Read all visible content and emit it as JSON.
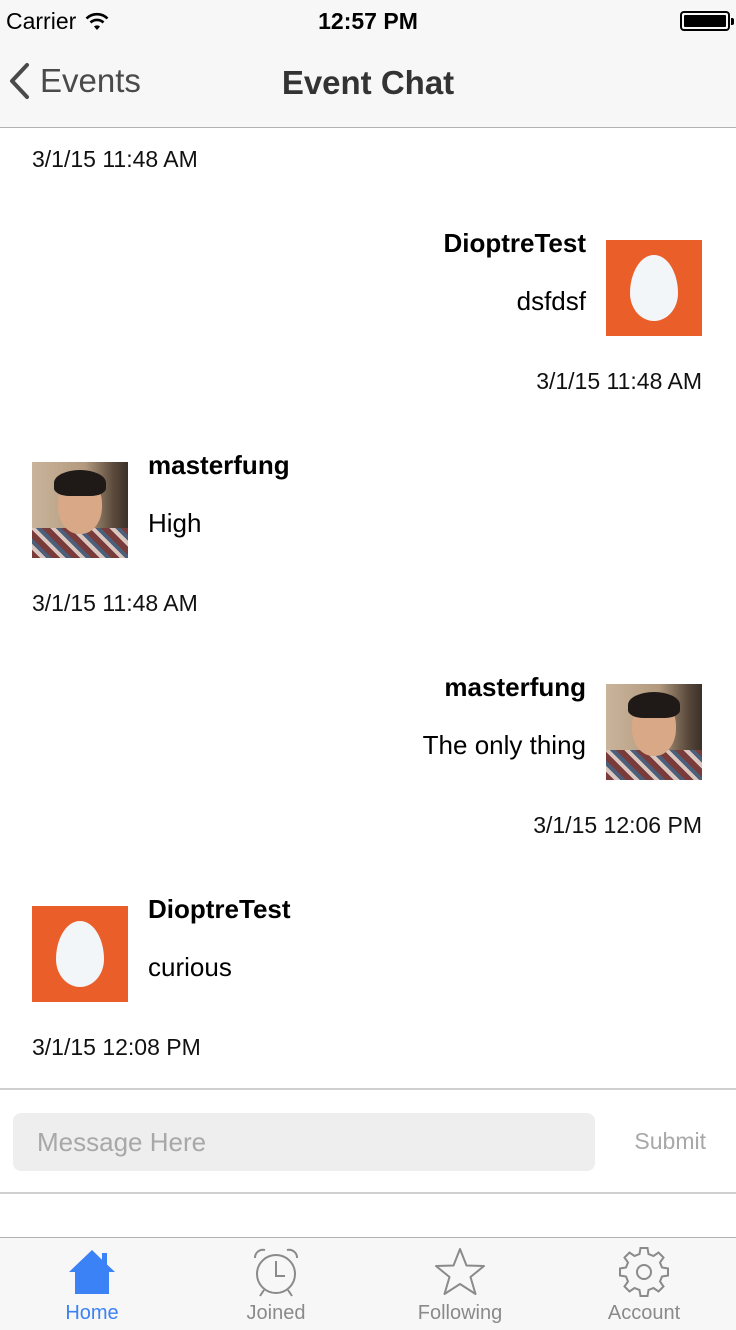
{
  "status_bar": {
    "carrier": "Carrier",
    "time": "12:57 PM"
  },
  "nav": {
    "back_label": "Events",
    "title": "Event Chat"
  },
  "chat": {
    "timestamps": [
      "3/1/15 11:48 AM",
      "3/1/15 11:48 AM",
      "3/1/15 11:48 AM",
      "3/1/15 12:06 PM",
      "3/1/15 12:08 PM"
    ],
    "messages": [
      {
        "sender": "DioptreTest",
        "text": "dsfdsf",
        "avatar": "egg-avatar",
        "side": "right"
      },
      {
        "sender": "masterfung",
        "text": "High",
        "avatar": "photo-avatar",
        "side": "left"
      },
      {
        "sender": "masterfung",
        "text": "The only thing",
        "avatar": "photo-avatar",
        "side": "right"
      },
      {
        "sender": "DioptreTest",
        "text": "curious",
        "avatar": "egg-avatar",
        "side": "left"
      }
    ]
  },
  "composer": {
    "placeholder": "Message Here",
    "value": "",
    "submit_label": "Submit"
  },
  "tabs": [
    {
      "label": "Home",
      "icon": "home-icon",
      "active": true
    },
    {
      "label": "Joined",
      "icon": "alarm-clock-icon",
      "active": false
    },
    {
      "label": "Following",
      "icon": "star-icon",
      "active": false
    },
    {
      "label": "Account",
      "icon": "gear-icon",
      "active": false
    }
  ],
  "colors": {
    "accent": "#3b82f6",
    "egg_avatar": "#ea5f29",
    "inactive": "#8a8a8a"
  }
}
